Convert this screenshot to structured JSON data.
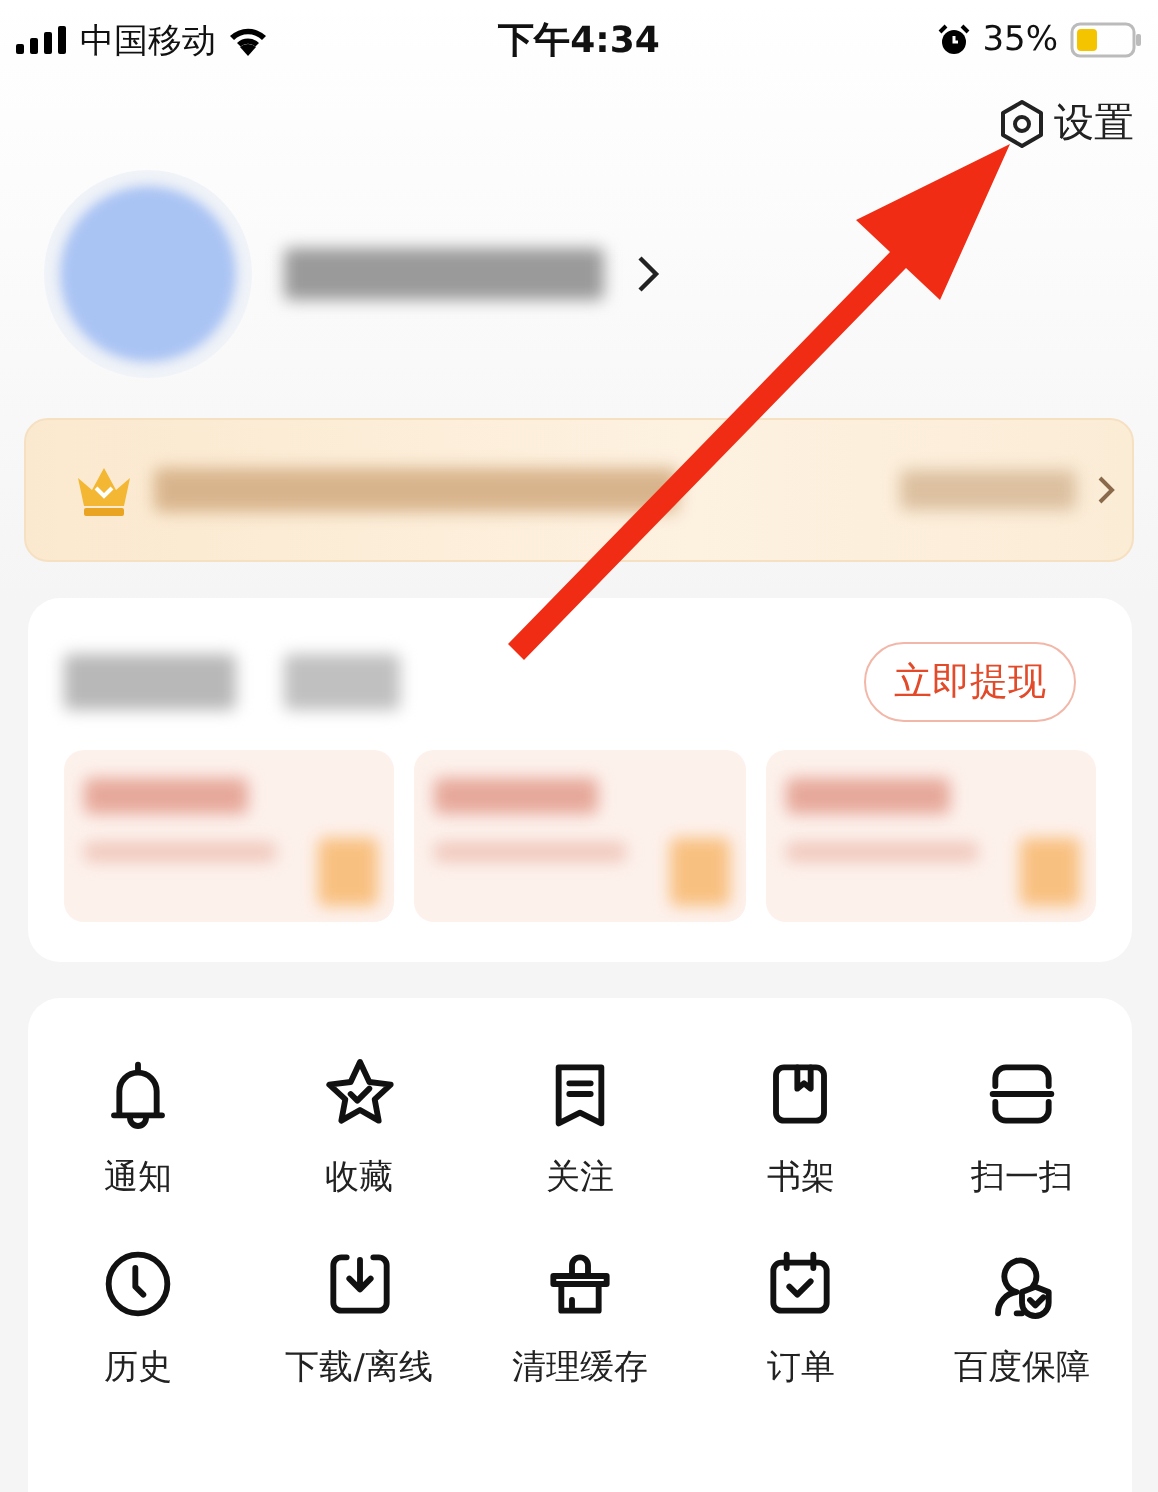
{
  "status_bar": {
    "carrier": "中国移动",
    "time": "下午4:34",
    "battery": "35%"
  },
  "header": {
    "settings": "设置"
  },
  "wallet": {
    "withdraw_button": "立即提现"
  },
  "shortcuts": [
    {
      "label": "通知",
      "kind": "bell"
    },
    {
      "label": "收藏",
      "kind": "star"
    },
    {
      "label": "关注",
      "kind": "note"
    },
    {
      "label": "书架",
      "kind": "book"
    },
    {
      "label": "扫一扫",
      "kind": "scan"
    },
    {
      "label": "历史",
      "kind": "clock"
    },
    {
      "label": "下载/离线",
      "kind": "download"
    },
    {
      "label": "清理缓存",
      "kind": "clean"
    },
    {
      "label": "订单",
      "kind": "calendar"
    },
    {
      "label": "百度保障",
      "kind": "shield"
    }
  ]
}
